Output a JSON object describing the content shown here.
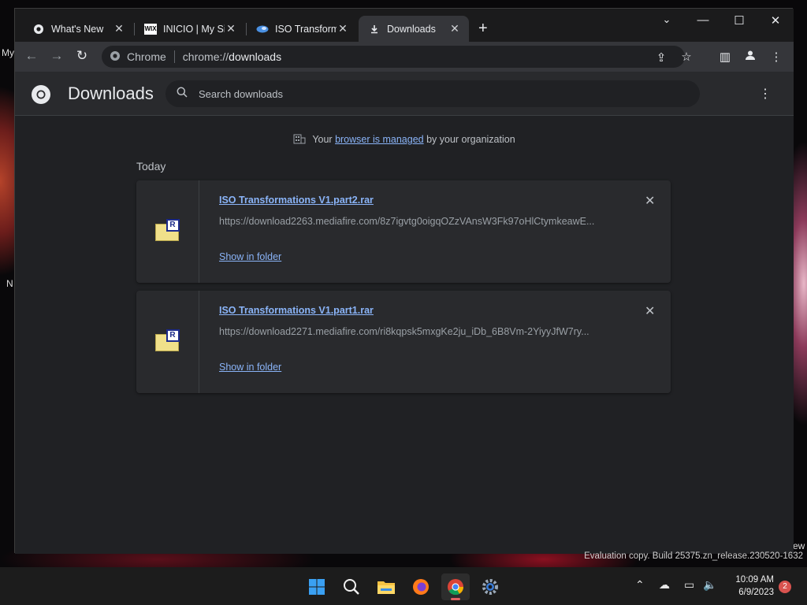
{
  "desktop": {
    "left_text_1": "My",
    "left_text_2": "N",
    "right_text": "ew"
  },
  "tabs": [
    {
      "label": "What's New",
      "icon": "chrome-logo-icon"
    },
    {
      "label": "INICIO | My Si",
      "icon": "wix-logo-icon"
    },
    {
      "label": "ISO Transform",
      "icon": "iso-site-icon"
    },
    {
      "label": "Downloads",
      "icon": "download-icon"
    }
  ],
  "toolbar": {
    "omnibox_chrome": "Chrome",
    "url_scheme": "chrome://",
    "url_path": "downloads"
  },
  "page": {
    "title": "Downloads",
    "search_placeholder": "Search downloads",
    "managed_prefix": "Your ",
    "managed_link": "browser is managed",
    "managed_suffix": " by your organization",
    "section_label": "Today"
  },
  "downloads": [
    {
      "filename": "ISO Transformations V1.part2.rar",
      "url": "https://download2263.mediafire.com/8z7igvtg0oigqOZzVAnsW3Fk97oHlCtymkeawE...",
      "action": "Show in folder"
    },
    {
      "filename": "ISO Transformations V1.part1.rar",
      "url": "https://download2271.mediafire.com/ri8kqpsk5mxgKe2ju_iDb_6B8Vm-2YiyyJfW7ry...",
      "action": "Show in folder"
    }
  ],
  "watermark": "Evaluation copy. Build 25375.zn_release.230520-1632",
  "taskbar": {
    "time": "10:09 AM",
    "date": "6/9/2023",
    "notifications": "2"
  },
  "colors": {
    "link": "#8ab4f8",
    "page_bg": "#202124",
    "card_bg": "#292a2d"
  }
}
